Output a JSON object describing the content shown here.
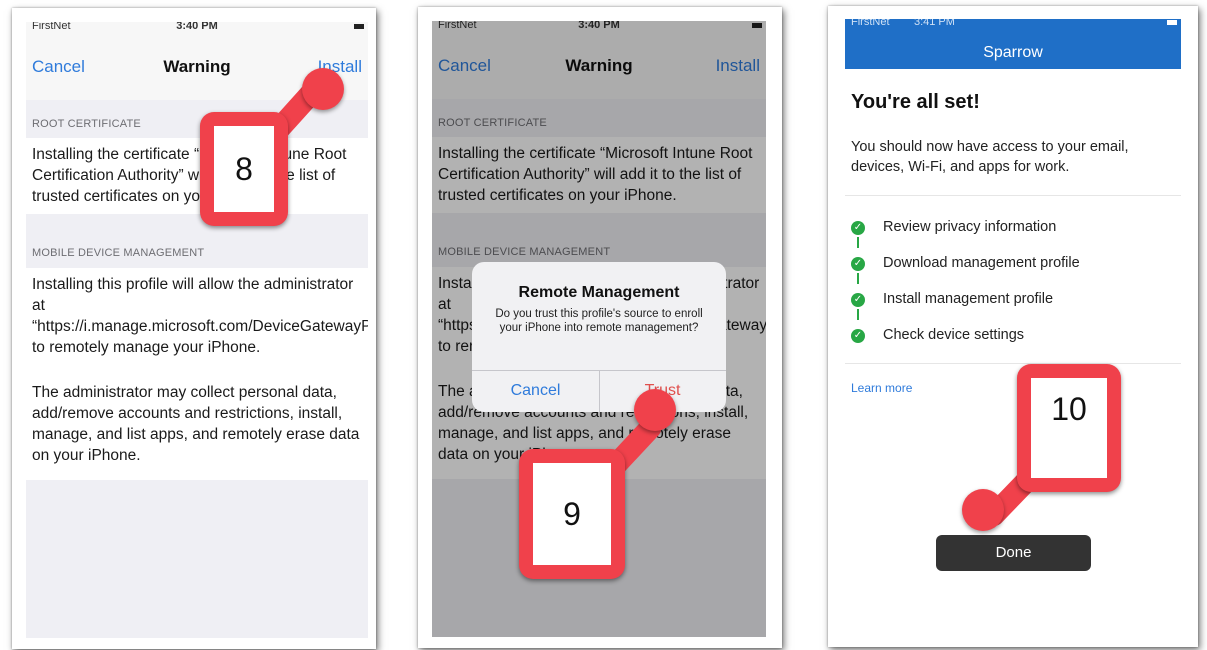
{
  "screen1": {
    "status": {
      "carrier": "FirstNet",
      "time": "3:40 PM"
    },
    "nav": {
      "cancel": "Cancel",
      "title": "Warning",
      "install": "Install"
    },
    "sections": [
      {
        "header": "ROOT CERTIFICATE",
        "text": "Installing the certificate “Microsoft Intune Root Certification Authority” will add it to the list of trusted certificates on your iPhone."
      },
      {
        "header": "MOBILE DEVICE MANAGEMENT",
        "text": "Installing this profile will allow the administrator at “https://i.manage.microsoft.com/DeviceGatewayProxy/ioshandler.ashx” to remotely manage your iPhone.",
        "text2": "The administrator may collect personal data, add/remove accounts and restrictions, install, manage, and list apps, and remotely erase data on your iPhone."
      }
    ],
    "callout": "8"
  },
  "screen2": {
    "status": {
      "carrier": "FirstNet",
      "time": "3:40 PM"
    },
    "nav": {
      "cancel": "Cancel",
      "title": "Warning",
      "install": "Install"
    },
    "sections": [
      {
        "header": "ROOT CERTIFICATE",
        "text": "Installing the certificate “Microsoft Intune Root Certification Authority” will add it to the list of trusted certificates on your iPhone."
      },
      {
        "header": "MOBILE DEVICE MANAGEMENT",
        "text": "Installing this profile will allow the administrator at “https://i.manage.microsoft.com/DeviceGatewayProxy/ioshandler.ashx” to remotely manage your iPhone.",
        "text2": "The administrator may collect personal data, add/remove accounts and restrictions, install, manage, and list apps, and remotely erase data on your iPhone."
      }
    ],
    "alert": {
      "title": "Remote Management",
      "message": "Do you trust this profile's source to enroll your iPhone into remote management?",
      "cancel": "Cancel",
      "trust": "Trust"
    },
    "callout": "9"
  },
  "screen3": {
    "status": {
      "carrier": "FirstNet",
      "time": "3:41 PM"
    },
    "header": "Sparrow",
    "title": "You're all set!",
    "description": "You should now have access to your email, devices, Wi-Fi, and apps for work.",
    "steps": [
      "Review privacy information",
      "Download management profile",
      "Install management profile",
      "Check device settings"
    ],
    "learn_more": "Learn more",
    "done": "Done",
    "callout": "10"
  },
  "colors": {
    "ios_blue": "#2f7bdb",
    "callout_red": "#f0414b",
    "sparrow_blue": "#1f6fc7",
    "check_green": "#28a745",
    "trust_red": "#e0504d"
  }
}
